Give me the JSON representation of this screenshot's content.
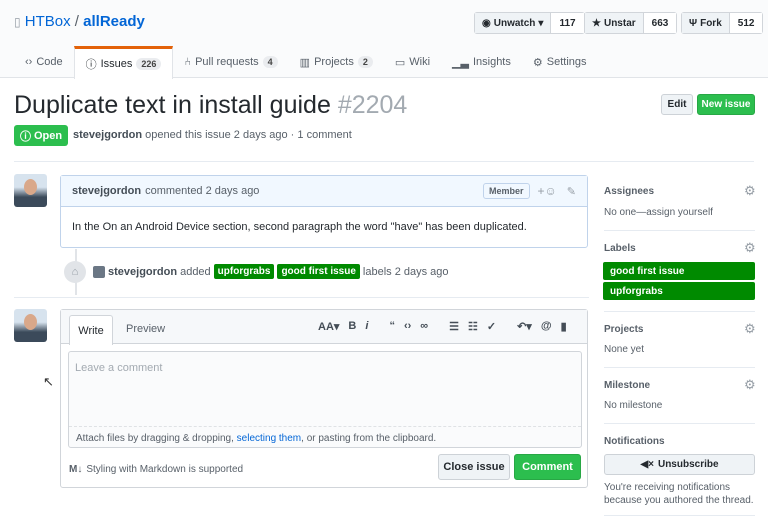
{
  "repo": {
    "owner": "HTBox",
    "separator": "/",
    "name": "allReady"
  },
  "actions": {
    "watch": {
      "label": "Unwatch",
      "count": "117"
    },
    "star": {
      "label": "Unstar",
      "count": "663"
    },
    "fork": {
      "label": "Fork",
      "count": "512"
    }
  },
  "tabs": [
    {
      "label": "Code"
    },
    {
      "label": "Issues",
      "count": "226"
    },
    {
      "label": "Pull requests",
      "count": "4"
    },
    {
      "label": "Projects",
      "count": "2"
    },
    {
      "label": "Wiki"
    },
    {
      "label": "Insights"
    },
    {
      "label": "Settings"
    }
  ],
  "issue": {
    "title": "Duplicate text in install guide",
    "number": "#2204",
    "state": "Open",
    "author": "stevejgordon",
    "meta": "opened this issue 2 days ago · 1 comment",
    "edit": "Edit",
    "new_issue": "New issue"
  },
  "comment": {
    "author": "stevejgordon",
    "time": "commented 2 days ago",
    "badge": "Member",
    "reaction": "+☺",
    "body": "In the On an Android Device section, second paragraph the word \"have\" has been duplicated."
  },
  "event": {
    "author": "stevejgordon",
    "action": "added",
    "labels": [
      "upforgrabs",
      "good first issue"
    ],
    "suffix": "labels 2 days ago"
  },
  "editor": {
    "tab_write": "Write",
    "tab_preview": "Preview",
    "placeholder": "Leave a comment",
    "attach_prefix": "Attach files by dragging & dropping, ",
    "attach_link": "selecting them",
    "attach_suffix": ", or pasting from the clipboard.",
    "markdown": "Styling with Markdown is supported",
    "close": "Close issue",
    "submit": "Comment"
  },
  "sidebar": {
    "assignees": {
      "title": "Assignees",
      "value": "No one—assign yourself"
    },
    "labels": {
      "title": "Labels",
      "items": [
        "good first issue",
        "upforgrabs"
      ]
    },
    "projects": {
      "title": "Projects",
      "value": "None yet"
    },
    "milestone": {
      "title": "Milestone",
      "value": "No milestone"
    },
    "notifications": {
      "title": "Notifications",
      "button": "Unsubscribe",
      "text": "You're receiving notifications because you authored the thread."
    }
  },
  "colors": {
    "green": "#2cbe4e",
    "label": "#008a00",
    "accent": "#e36209",
    "link": "#0366d6"
  }
}
